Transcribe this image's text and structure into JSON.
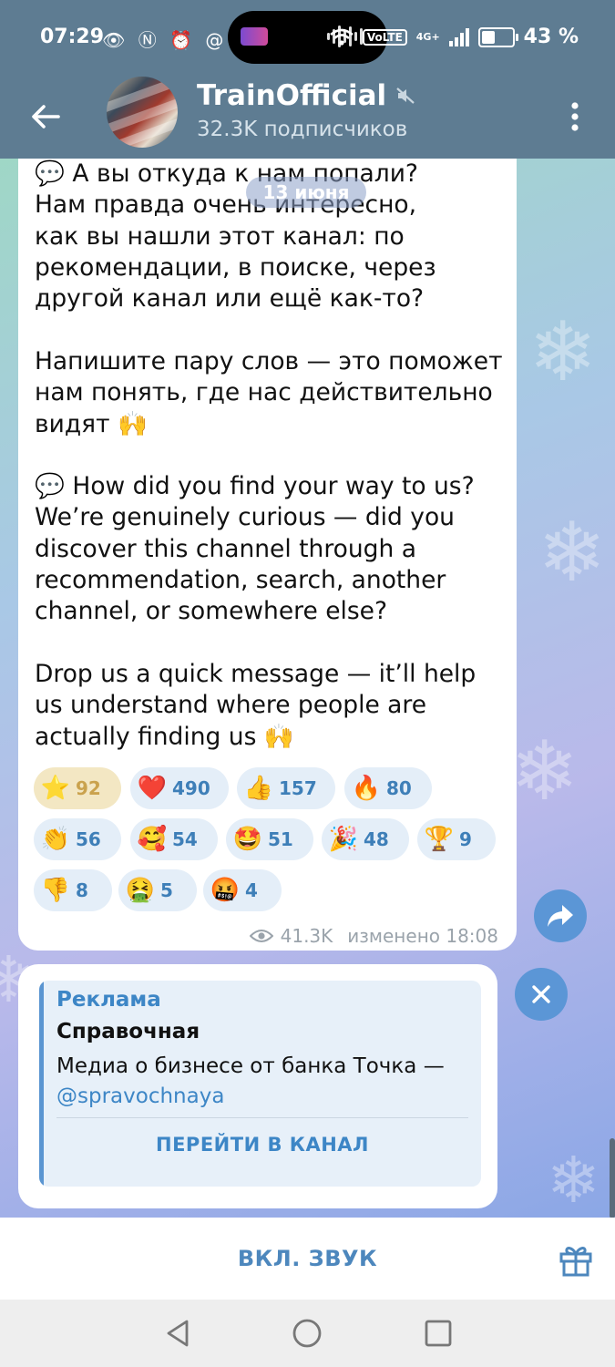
{
  "status_bar": {
    "time": "07:29",
    "left_icons": "👁 Ⓝ ⏰ @",
    "network_chip": "VoLTE",
    "network_type": "4G+",
    "battery_percent": "43 %",
    "battery_level": 0.43
  },
  "header": {
    "channel_name": "TrainOfficial",
    "subscribers": "32.3K подписчиков",
    "icons": [
      "back-arrow-icon",
      "muted-speaker-icon",
      "more-vert-icon"
    ]
  },
  "date_badge": "13 июня",
  "message": {
    "paragraphs": [
      "💬 А вы откуда к нам попали?\nНам правда очень интересно,\nкак вы нашли этот канал: по\nрекомендации, в поиске, через\nдругой канал или ещё как-то?",
      "Напишите пару слов — это поможет\nнам понять, где нас действительно\nвидят 🙌",
      "💬 How did you find your way to us?\nWe’re genuinely curious — did you\ndiscover this channel through a\nrecommendation, search, another\nchannel, or somewhere else?",
      "Drop us a quick message — it’ll help\nus understand where people are\nactually finding us 🙌"
    ],
    "reactions": [
      {
        "emoji": "⭐",
        "count": "92"
      },
      {
        "emoji": "❤️",
        "count": "490"
      },
      {
        "emoji": "👍",
        "count": "157"
      },
      {
        "emoji": "🔥",
        "count": "80"
      },
      {
        "emoji": "👏",
        "count": "56"
      },
      {
        "emoji": "🥰",
        "count": "54"
      },
      {
        "emoji": "🤩",
        "count": "51"
      },
      {
        "emoji": "🎉",
        "count": "48"
      },
      {
        "emoji": "🏆",
        "count": "9"
      },
      {
        "emoji": "👎",
        "count": "8"
      },
      {
        "emoji": "🤮",
        "count": "5"
      },
      {
        "emoji": "🤬",
        "count": "4"
      }
    ],
    "views": "41.3K",
    "edited_time": "изменено 18:08"
  },
  "ad": {
    "tag": "Реклама",
    "name": "Справочная",
    "text": "Медиа о бизнесе от банка Точка — ",
    "mention": "@spravochnaya",
    "button": "ПЕРЕЙТИ В КАНАЛ"
  },
  "bottom": {
    "unmute_label": "ВКЛ. ЗВУК"
  },
  "colors": {
    "header": "#5e7c92",
    "accent": "#4d87bd",
    "link": "#3d86c6"
  }
}
